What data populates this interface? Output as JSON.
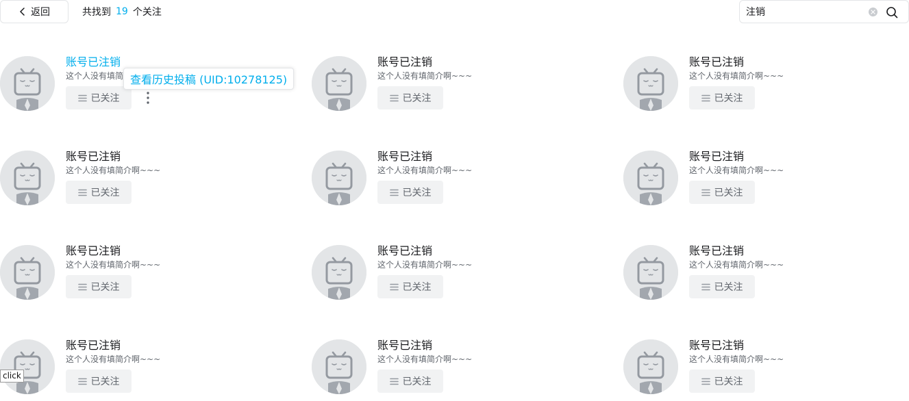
{
  "header": {
    "back_label": "返回",
    "summary_prefix": "共找到",
    "summary_count": "19",
    "summary_suffix": "个关注"
  },
  "search": {
    "value": "注销",
    "placeholder": ""
  },
  "tooltip": {
    "text": "查看历史投稿 (UID:10278125)"
  },
  "users": [
    {
      "name": "账号已注销",
      "sign": "这个人没有填简介啊~~~",
      "follow_label": "已关注"
    },
    {
      "name": "账号已注销",
      "sign": "这个人没有填简介啊~~~",
      "follow_label": "已关注"
    },
    {
      "name": "账号已注销",
      "sign": "这个人没有填简介啊~~~",
      "follow_label": "已关注"
    },
    {
      "name": "账号已注销",
      "sign": "这个人没有填简介啊~~~",
      "follow_label": "已关注"
    },
    {
      "name": "账号已注销",
      "sign": "这个人没有填简介啊~~~",
      "follow_label": "已关注"
    },
    {
      "name": "账号已注销",
      "sign": "这个人没有填简介啊~~~",
      "follow_label": "已关注"
    },
    {
      "name": "账号已注销",
      "sign": "这个人没有填简介啊~~~",
      "follow_label": "已关注"
    },
    {
      "name": "账号已注销",
      "sign": "这个人没有填简介啊~~~",
      "follow_label": "已关注"
    },
    {
      "name": "账号已注销",
      "sign": "这个人没有填简介啊~~~",
      "follow_label": "已关注"
    },
    {
      "name": "账号已注销",
      "sign": "这个人没有填简介啊~~~",
      "follow_label": "已关注"
    },
    {
      "name": "账号已注销",
      "sign": "这个人没有填简介啊~~~",
      "follow_label": "已关注"
    },
    {
      "name": "账号已注销",
      "sign": "这个人没有填简介啊~~~",
      "follow_label": "已关注"
    }
  ],
  "debug_tag": "click",
  "colors": {
    "accent": "#00aeec",
    "text": "#18191c",
    "muted": "#61666d",
    "button_bg": "#f1f2f3"
  }
}
